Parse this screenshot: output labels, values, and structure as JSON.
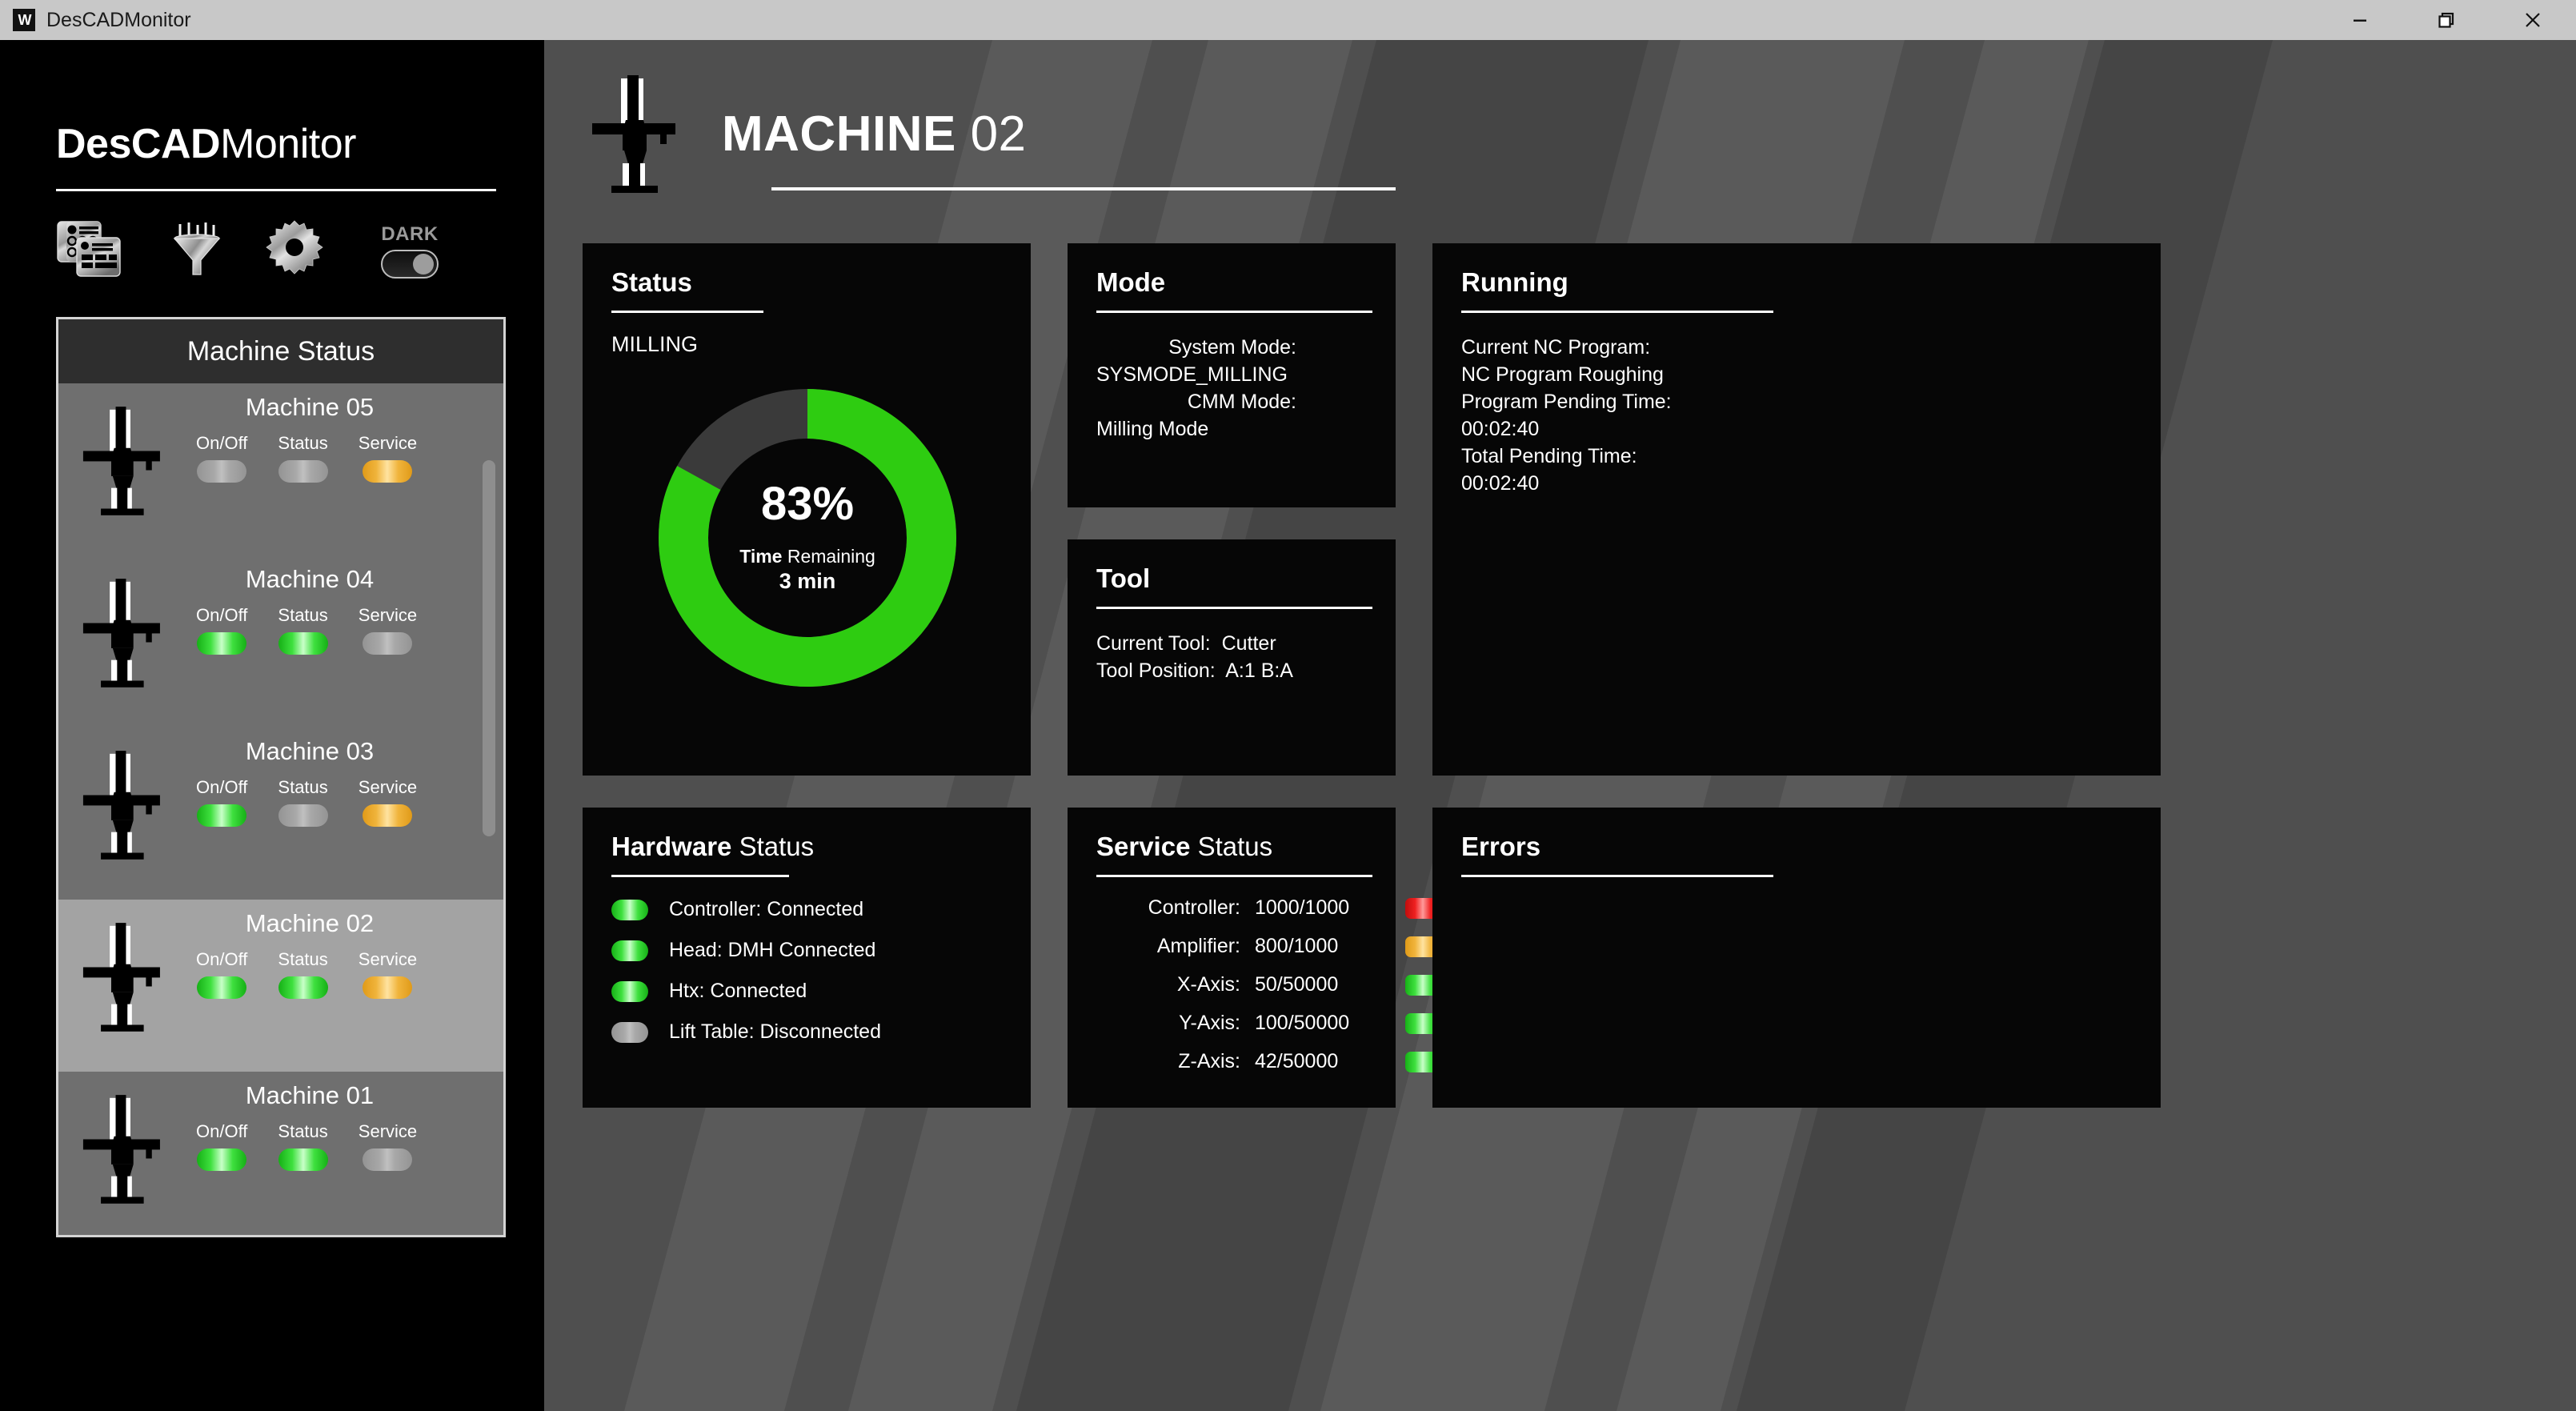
{
  "window": {
    "title": "DesCADMonitor",
    "logo_glyph": "W",
    "minimize_label": "Minimize",
    "maximize_label": "Restore",
    "close_label": "Close"
  },
  "sidebar": {
    "brand_bold": "DesCAD",
    "brand_light": "Monitor",
    "tools": [
      {
        "name": "panels-icon",
        "label": "Panels"
      },
      {
        "name": "filter-icon",
        "label": "Filter"
      },
      {
        "name": "gear-icon",
        "label": "Settings"
      }
    ],
    "dark_toggle": {
      "label": "DARK",
      "state": "on"
    },
    "machine_status_header": "Machine Status",
    "led_labels": {
      "onoff": "On/Off",
      "status": "Status",
      "service": "Service"
    },
    "machines": [
      {
        "name": "Machine 01",
        "onoff": "green",
        "status": "green",
        "service": "gray",
        "selected": false
      },
      {
        "name": "Machine 02",
        "onoff": "green",
        "status": "green",
        "service": "orange",
        "selected": true
      },
      {
        "name": "Machine 03",
        "onoff": "green",
        "status": "gray",
        "service": "orange",
        "selected": false
      },
      {
        "name": "Machine 04",
        "onoff": "green",
        "status": "green",
        "service": "gray",
        "selected": false
      },
      {
        "name": "Machine 05",
        "onoff": "gray",
        "status": "gray",
        "service": "orange",
        "selected": false
      }
    ]
  },
  "header": {
    "title_bold": "MACHINE",
    "title_light": "02"
  },
  "cards": {
    "status": {
      "title_bold": "Status",
      "title_light": "",
      "state": "MILLING",
      "percent_label": "83%",
      "percent_value": 83,
      "remaining_bold": "Time",
      "remaining_light": "Remaining",
      "remaining_value": "3 min",
      "arc_color": "#2ecc11",
      "track_color": "#3a3a3a"
    },
    "mode": {
      "title_bold": "Mode",
      "title_light": "",
      "rows": [
        {
          "key": "System Mode:",
          "value": "SYSMODE_MILLING"
        },
        {
          "key": "CMM Mode:",
          "value": "Milling Mode"
        }
      ]
    },
    "tool": {
      "title_bold": "Tool",
      "title_light": "",
      "rows": [
        {
          "key": "Current Tool:",
          "value": "Cutter"
        },
        {
          "key": "Tool Position:",
          "value": "A:1 B:A"
        }
      ]
    },
    "running": {
      "title_bold": "Running",
      "title_light": "",
      "rows": [
        {
          "key": "Current NC Program:",
          "value": "NC Program Roughing"
        },
        {
          "key": "Program Pending Time:",
          "value": "00:02:40"
        },
        {
          "key": "Total Pending Time:",
          "value": "00:02:40"
        }
      ]
    },
    "hardware": {
      "title_bold": "Hardware",
      "title_light": "Status",
      "rows": [
        {
          "led": "green",
          "text": "Controller: Connected"
        },
        {
          "led": "green",
          "text": "Head: DMH Connected"
        },
        {
          "led": "green",
          "text": "Htx: Connected"
        },
        {
          "led": "gray",
          "text": "Lift Table: Disconnected"
        }
      ]
    },
    "service": {
      "title_bold": "Service",
      "title_light": "Status",
      "rows": [
        {
          "name": "Controller:",
          "value": "1000/1000",
          "led": "red"
        },
        {
          "name": "Amplifier:",
          "value": "800/1000",
          "led": "orange"
        },
        {
          "name": "X-Axis:",
          "value": "50/50000",
          "led": "green"
        },
        {
          "name": "Y-Axis:",
          "value": "100/50000",
          "led": "green"
        },
        {
          "name": "Z-Axis:",
          "value": "42/50000",
          "led": "green"
        }
      ]
    },
    "errors": {
      "title_bold": "Errors",
      "title_light": "",
      "rows": []
    }
  }
}
